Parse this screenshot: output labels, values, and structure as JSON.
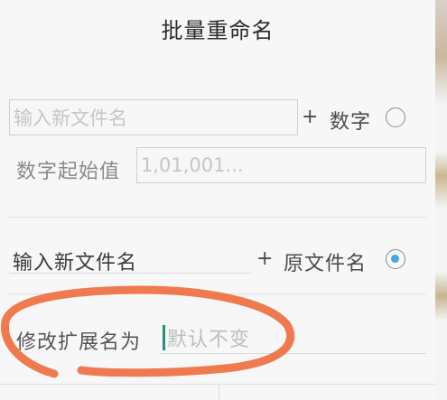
{
  "dialog": {
    "title": "批量重命名",
    "number_option": {
      "input_placeholder": "输入新文件名",
      "plus": "+",
      "label": "数字",
      "selected": false,
      "start_label": "数字起始值",
      "start_placeholder": "1,01,001..."
    },
    "original_option": {
      "input_value": "输入新文件名",
      "plus": "+",
      "label": "原文件名",
      "selected": true
    },
    "extension": {
      "label": "修改扩展名为",
      "placeholder": "默认不变"
    }
  },
  "annotation": {
    "color": "#f07a4f"
  }
}
